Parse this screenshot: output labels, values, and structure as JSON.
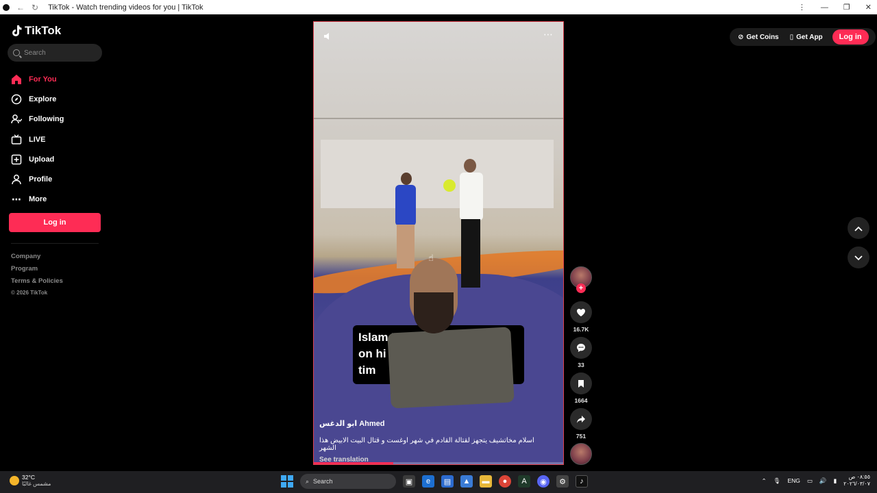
{
  "window": {
    "title": "TikTok - Watch trending videos for you | TikTok"
  },
  "sidebar": {
    "logo": "TikTok",
    "search_placeholder": "Search",
    "nav": [
      {
        "label": "For You",
        "icon": "home-icon",
        "active": true
      },
      {
        "label": "Explore",
        "icon": "compass-icon",
        "active": false
      },
      {
        "label": "Following",
        "icon": "following-users-icon",
        "active": false
      },
      {
        "label": "LIVE",
        "icon": "live-tv-icon",
        "active": false
      },
      {
        "label": "Upload",
        "icon": "upload-plus-icon",
        "active": false
      },
      {
        "label": "Profile",
        "icon": "person-icon",
        "active": false
      },
      {
        "label": "More",
        "icon": "ellipsis-icon",
        "active": false
      }
    ],
    "login_label": "Log in",
    "footer": {
      "company": "Company",
      "program": "Program",
      "terms": "Terms & Policies",
      "copyright": "© 2026 TikTok"
    }
  },
  "video": {
    "caption_lines": [
      "Islam Mak         ng",
      "on hi               wo",
      "tim"
    ],
    "author": "ابو الدغس Ahmed",
    "description": "اسلام مخاتشيف يتجهز لقتالة القادم في شهر اوغست و قتال البيت الابيض هذا الشهر",
    "see_translation": "See translation",
    "progress_fraction": 0.32
  },
  "actions": {
    "likes": "16.7K",
    "comments": "33",
    "saves": "1664",
    "shares": "751"
  },
  "topbar": {
    "get_coins": "Get Coins",
    "get_app": "Get App",
    "login": "Log in"
  },
  "taskbar": {
    "temperature": "32°C",
    "weather_desc": "مشمس غالبًا",
    "search": "Search",
    "language": "ENG",
    "time": "٠٨:٥٥ ص",
    "date": "٢٠٢٦/٠٣/٠٧"
  },
  "colors": {
    "accent": "#fe2c55",
    "background": "#000000"
  }
}
